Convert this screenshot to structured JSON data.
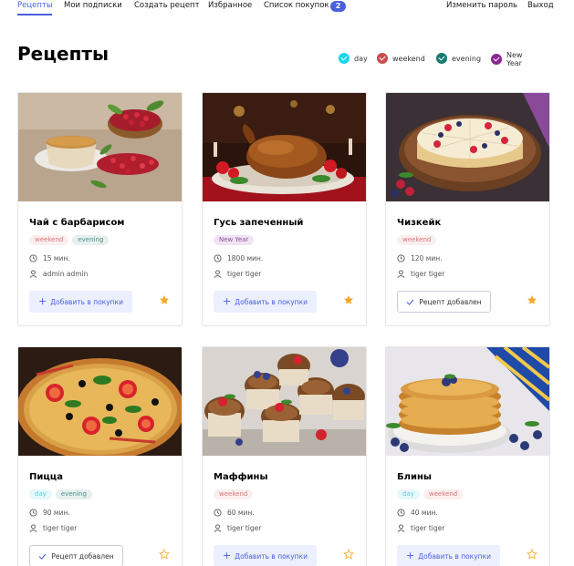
{
  "nav": {
    "items": [
      {
        "label": "Рецепты",
        "active": true
      },
      {
        "label": "Мои подписки"
      },
      {
        "label": "Создать рецепт"
      },
      {
        "label": "Избранное"
      },
      {
        "label": "Список покупок"
      }
    ],
    "cart_count": "2",
    "change_password": "Изменить пароль",
    "logout": "Выход"
  },
  "page": {
    "title": "Рецепты"
  },
  "filters": [
    {
      "label": "day",
      "color": "#1ad6ee",
      "checked": true
    },
    {
      "label": "weekend",
      "color": "#c84f51",
      "checked": true
    },
    {
      "label": "evening",
      "color": "#197b72",
      "checked": true
    },
    {
      "label": "New Year",
      "color": "#8a2793",
      "checked": true
    }
  ],
  "colors": {
    "accent": "#4a61dd",
    "star": "#f5a623"
  },
  "recipes": [
    {
      "title": "Чай с барбарисом",
      "tags": [
        "weekend",
        "evening"
      ],
      "time": "15 мин.",
      "author": "admin admin",
      "button": "Добавить в покупки",
      "added": false,
      "favorite": true,
      "image": "tea-with-barberries"
    },
    {
      "title": "Гусь запеченный",
      "tags": [
        "New Year"
      ],
      "time": "1800 мин.",
      "author": "tiger tiger",
      "button": "Добавить в покупки",
      "added": false,
      "favorite": true,
      "image": "roasted-goose"
    },
    {
      "title": "Чизкейк",
      "tags": [
        "weekend"
      ],
      "time": "120 мин.",
      "author": "tiger tiger",
      "button": "Рецепт добавлен",
      "added": true,
      "favorite": true,
      "image": "cheesecake"
    },
    {
      "title": "Пицца",
      "tags": [
        "day",
        "evening"
      ],
      "time": "90 мин.",
      "author": "tiger tiger",
      "button": "Рецепт добавлен",
      "added": true,
      "favorite": false,
      "image": "pizza"
    },
    {
      "title": "Маффины",
      "tags": [
        "weekend"
      ],
      "time": "60 мин.",
      "author": "tiger tiger",
      "button": "Добавить в покупки",
      "added": false,
      "favorite": false,
      "image": "muffins"
    },
    {
      "title": "Блины",
      "tags": [
        "day",
        "weekend"
      ],
      "time": "40 мин.",
      "author": "tiger tiger",
      "button": "Добавить в покупки",
      "added": false,
      "favorite": false,
      "image": "pancakes"
    }
  ]
}
